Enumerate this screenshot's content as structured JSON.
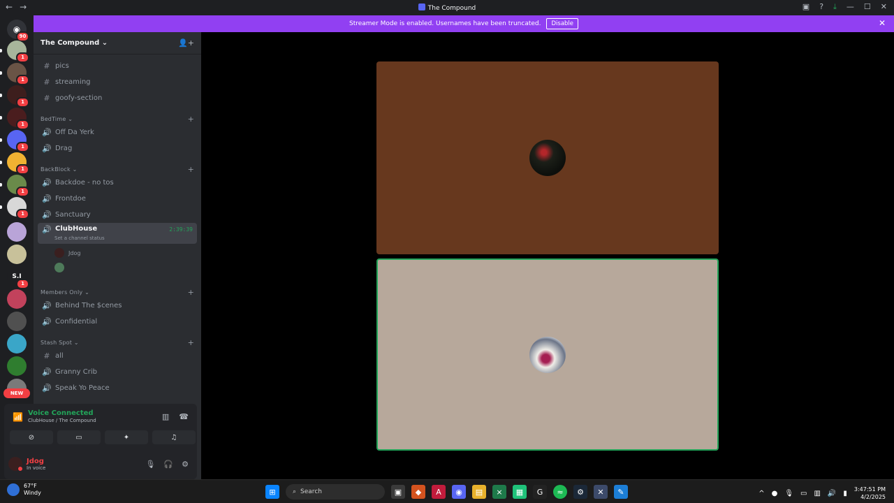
{
  "window": {
    "title": "The Compound",
    "back": "←",
    "forward": "→",
    "icons": [
      "▣",
      "?",
      "⤓",
      "—",
      "☐",
      "✕"
    ]
  },
  "banner": {
    "text": "Streamer Mode is enabled. Usernames have been truncated.",
    "button": "Disable",
    "close": "✕"
  },
  "guilds": {
    "home_badge": "90",
    "badge": "1",
    "new_label": "NEW",
    "si_label": "S.I"
  },
  "server": {
    "name": "The Compound",
    "caret": "⌄",
    "invite_icon": "👤+"
  },
  "channels": {
    "pics": "pics",
    "streaming": "streaming",
    "goofy": "goofy-section",
    "cat_bedtime": "BedTime",
    "off_da_yerk": "Off Da Yerk",
    "drag": "Drag",
    "cat_backblock": "BackBlock",
    "backdoe": "Backdoe - no tos",
    "frontdoe": "Frontdoe",
    "sanctuary": "Sanctuary",
    "clubhouse": "ClubHouse",
    "clubhouse_timer": "2:39:39",
    "clubhouse_status": "Set a channel status",
    "user_jdog": "Jdog",
    "cat_members": "Members Only",
    "behind": "Behind The $cenes",
    "confidential": "Confidential",
    "cat_stash": "Stash Spot",
    "all": "all",
    "granny": "Granny Crib",
    "speak": "Speak Yo Peace"
  },
  "voice": {
    "status": "Voice Connected",
    "location": "ClubHouse / The Compound"
  },
  "user": {
    "name": "Jdog",
    "status": "In voice"
  },
  "taskbar": {
    "temp": "67°F",
    "condition": "Windy",
    "search": "Search",
    "time": "3:47:51 PM",
    "date": "4/2/2025"
  },
  "colors": {
    "accent": "#9140f2",
    "voice_green": "#23a55a",
    "tile1": "#67381e",
    "tile2": "#b7a89b"
  }
}
